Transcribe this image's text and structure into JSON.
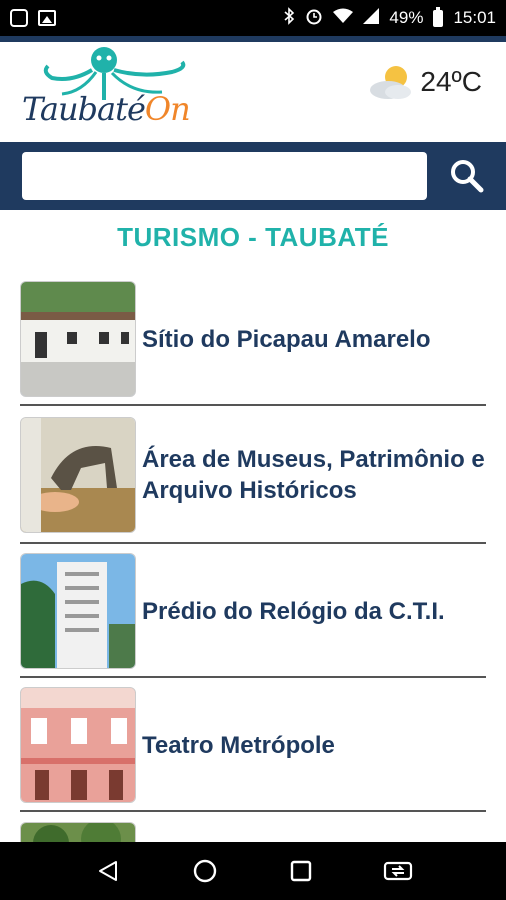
{
  "status_bar": {
    "battery": "49%",
    "time": "15:01",
    "icons": [
      "instagram-icon",
      "image-icon",
      "bluetooth-icon",
      "alarm-icon",
      "wifi-icon",
      "signal-icon",
      "battery-icon"
    ]
  },
  "header": {
    "logo_main": "Taubaté",
    "logo_accent": "On",
    "weather_temp": "24ºC",
    "weather_icon": "partly-cloudy-icon"
  },
  "search": {
    "placeholder": "",
    "value": "",
    "button_icon": "search-icon"
  },
  "page": {
    "title": "TURISMO - TAUBATÉ"
  },
  "items": [
    {
      "label": "Sítio do Picapau Amarelo"
    },
    {
      "label": "Área de Museus, Patrimônio e Arquivo Históricos"
    },
    {
      "label": "Prédio do Relógio da C.T.I."
    },
    {
      "label": "Teatro Metrópole"
    },
    {
      "label": ""
    }
  ],
  "colors": {
    "brand_navy": "#1f3a5f",
    "brand_teal": "#20b2aa",
    "brand_orange": "#f0862a"
  }
}
